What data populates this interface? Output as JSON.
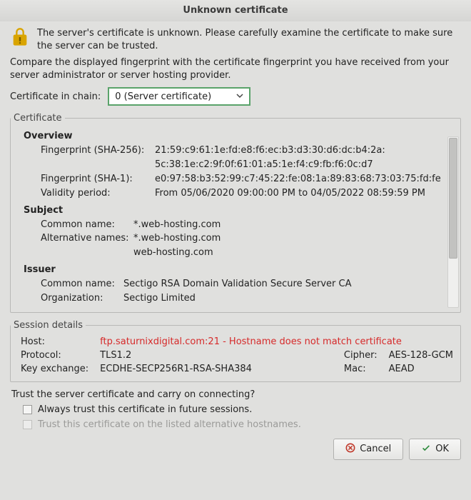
{
  "title": "Unknown certificate",
  "intro1": "The server's certificate is unknown. Please carefully examine the certificate to make sure the server can be trusted.",
  "intro2": "Compare the displayed fingerprint with the certificate fingerprint you have received from your server administrator or server hosting provider.",
  "chain": {
    "label": "Certificate in chain:",
    "selected": "0 (Server certificate)"
  },
  "certificate": {
    "legend": "Certificate",
    "overview": {
      "head": "Overview",
      "fp256_label": "Fingerprint (SHA-256):",
      "fp256_l1": "21:59:c9:61:1e:fd:e8:f6:ec:b3:d3:30:d6:dc:b4:2a:",
      "fp256_l2": "5c:38:1e:c2:9f:0f:61:01:a5:1e:f4:c9:fb:f6:0c:d7",
      "fp1_label": "Fingerprint (SHA-1):",
      "fp1": "e0:97:58:b3:52:99:c7:45:22:fe:08:1a:89:83:68:73:03:75:fd:fe",
      "validity_label": "Validity period:",
      "validity": "From 05/06/2020 09:00:00 PM to 04/05/2022 08:59:59 PM"
    },
    "subject": {
      "head": "Subject",
      "cn_label": "Common name:",
      "cn": "*.web-hosting.com",
      "alt_label": "Alternative names:",
      "alt1": "*.web-hosting.com",
      "alt2": "web-hosting.com"
    },
    "issuer": {
      "head": "Issuer",
      "cn_label": "Common name:",
      "cn": "Sectigo RSA Domain Validation Secure Server CA",
      "org_label": "Organization:",
      "org": "Sectigo Limited"
    }
  },
  "session": {
    "legend": "Session details",
    "host_label": "Host:",
    "host": "ftp.saturnixdigital.com:21 - Hostname does not match certificate",
    "proto_label": "Protocol:",
    "proto": "TLS1.2",
    "cipher_label": "Cipher:",
    "cipher": "AES-128-GCM",
    "kex_label": "Key exchange:",
    "kex": "ECDHE-SECP256R1-RSA-SHA384",
    "mac_label": "Mac:",
    "mac": "AEAD"
  },
  "trust": {
    "question": "Trust the server certificate and carry on connecting?",
    "always": "Always trust this certificate in future sessions.",
    "alt": "Trust this certificate on the listed alternative hostnames."
  },
  "buttons": {
    "cancel": "Cancel",
    "ok": "OK"
  }
}
